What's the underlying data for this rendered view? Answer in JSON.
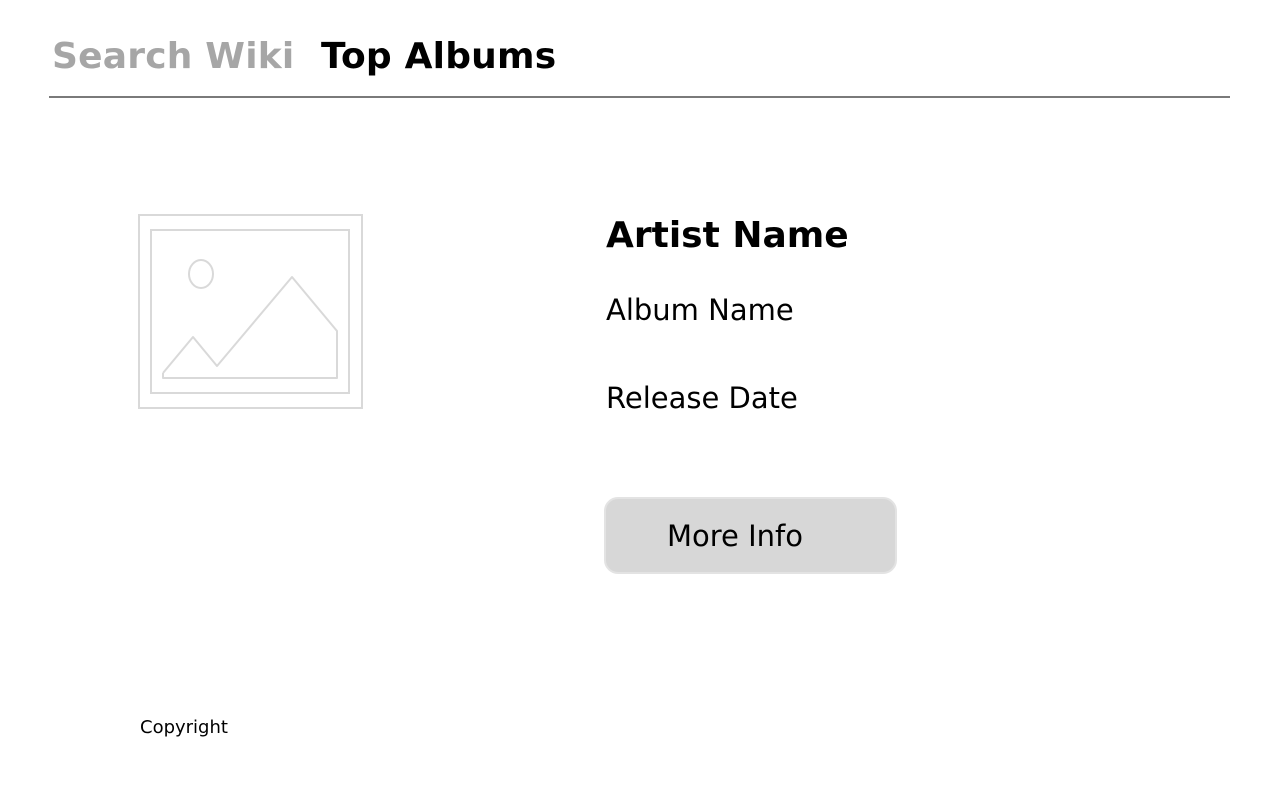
{
  "nav": {
    "tabs": [
      {
        "label": "Search Wiki",
        "active": false
      },
      {
        "label": "Top Albums",
        "active": true
      }
    ]
  },
  "album": {
    "artist_name": "Artist Name",
    "album_name": "Album Name",
    "release_date": "Release Date",
    "image_icon": "image-placeholder-icon"
  },
  "actions": {
    "more_info_label": "More Info"
  },
  "footer": {
    "copyright": "Copyright"
  },
  "colors": {
    "inactive_tab": "#a6a6a6",
    "active_tab": "#000000",
    "divider": "#7a7a7a",
    "button_bg": "#d7d7d7",
    "placeholder_stroke": "#d9d9d9"
  }
}
